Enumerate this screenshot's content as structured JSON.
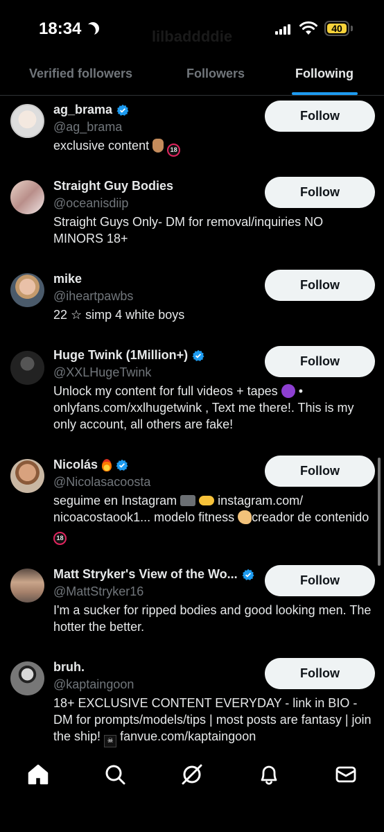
{
  "status_bar": {
    "time": "18:34",
    "battery": "40"
  },
  "header": {
    "title": "lilbaddddie"
  },
  "tabs": [
    {
      "label": "Verified followers",
      "active": false
    },
    {
      "label": "Followers",
      "active": false
    },
    {
      "label": "Following",
      "active": true
    }
  ],
  "accent_color": "#1d9bf0",
  "users": [
    {
      "name": "ag_brama",
      "verified": true,
      "handle": "@ag_brama",
      "bio": "exclusive content",
      "button": "Follow"
    },
    {
      "name": "Straight Guy Bodies",
      "verified": false,
      "handle": "@oceanisdiip",
      "bio": "Straight Guys Only- DM for removal/inquiries NO MINORS 18+",
      "button": "Follow"
    },
    {
      "name": "mike",
      "verified": false,
      "handle": "@iheartpawbs",
      "bio": "22 ☆ simp 4 white boys",
      "button": "Follow"
    },
    {
      "name": "Huge Twink (1Million+)",
      "verified": true,
      "handle": "@XXLHugeTwink",
      "bio_a": "Unlock my content for full videos + tapes",
      "bio_b": " • onlyfans.com/xxlhugetwink , Text me there!. This is my only account, all others are fake!",
      "button": "Follow"
    },
    {
      "name": "Nicolás",
      "verified": true,
      "handle": "@Nicolasacoosta",
      "bio_a": "seguime en Instagram",
      "bio_b": "instagram.com/ nicoacostaook1... modelo fitness",
      "bio_c": "creador de contenido",
      "button": "Follow"
    },
    {
      "name": "Matt Stryker's View of the Wo...",
      "verified": true,
      "handle": "@MattStryker16",
      "bio": "I'm a sucker for ripped bodies and good looking men. The hotter the better.",
      "button": "Follow"
    },
    {
      "name": "bruh.",
      "verified": false,
      "handle": "@kaptaingoon",
      "bio_a": "18+ EXCLUSIVE CONTENT EVERYDAY - link in BIO - DM for prompts/models/tips | most posts are fantasy | join the ship!",
      "bio_b": "fanvue.com/kaptaingoon",
      "button": "Follow"
    }
  ],
  "nav": [
    "home-icon",
    "search-icon",
    "grok-icon",
    "notifications-icon",
    "messages-icon"
  ]
}
